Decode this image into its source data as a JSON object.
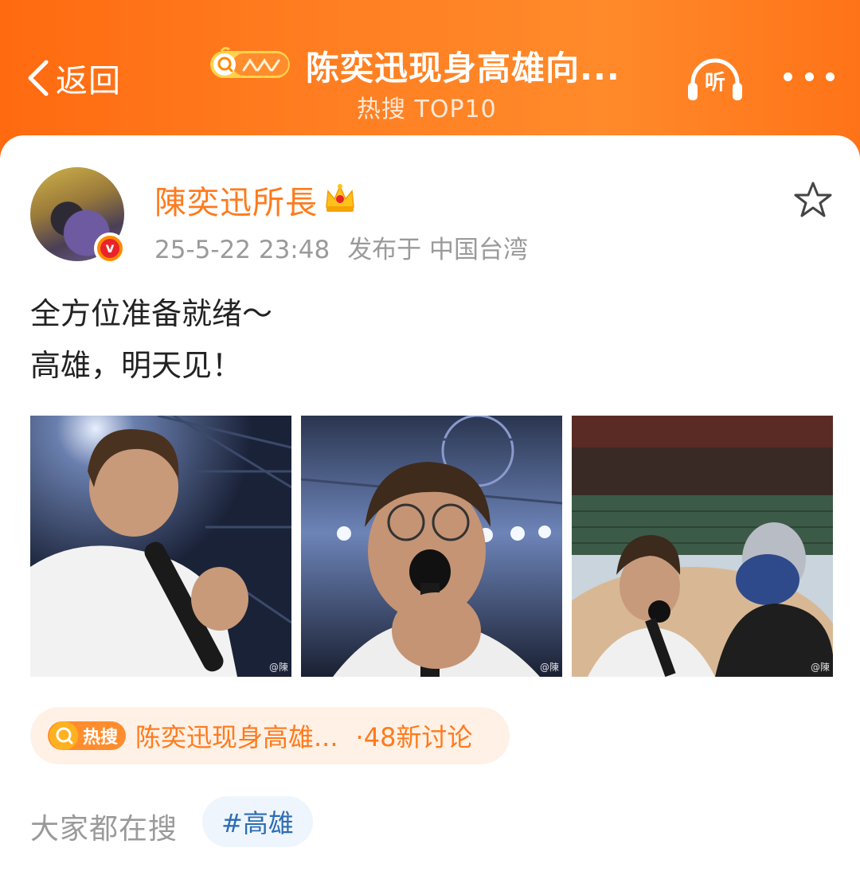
{
  "header": {
    "back_label": "返回",
    "title": "陈奕迅现身高雄向...",
    "subtitle": "热搜 TOP10",
    "listen_label": "听"
  },
  "post": {
    "author": "陳奕迅所長",
    "time": "25-5-22 23:48",
    "location": "发布于 中国台湾",
    "verified_mark": "v",
    "text_lines": [
      "全方位准备就绪～",
      "高雄，明天见！"
    ],
    "photo_watermark": "@陳"
  },
  "hot_topic": {
    "badge": "热搜",
    "name": "陈奕迅现身高雄...",
    "count": "·48新讨论"
  },
  "related": {
    "label": "大家都在搜",
    "tag": "#高雄"
  },
  "colors": {
    "brand_orange": "#ff7a1c",
    "tag_blue": "#2d6db3",
    "meta_gray": "#9a9a9a"
  },
  "icons": [
    "back-chevron-icon",
    "hot-search-logo-icon",
    "headphones-icon",
    "more-icon",
    "crown-icon",
    "star-icon",
    "verified-badge-icon"
  ]
}
